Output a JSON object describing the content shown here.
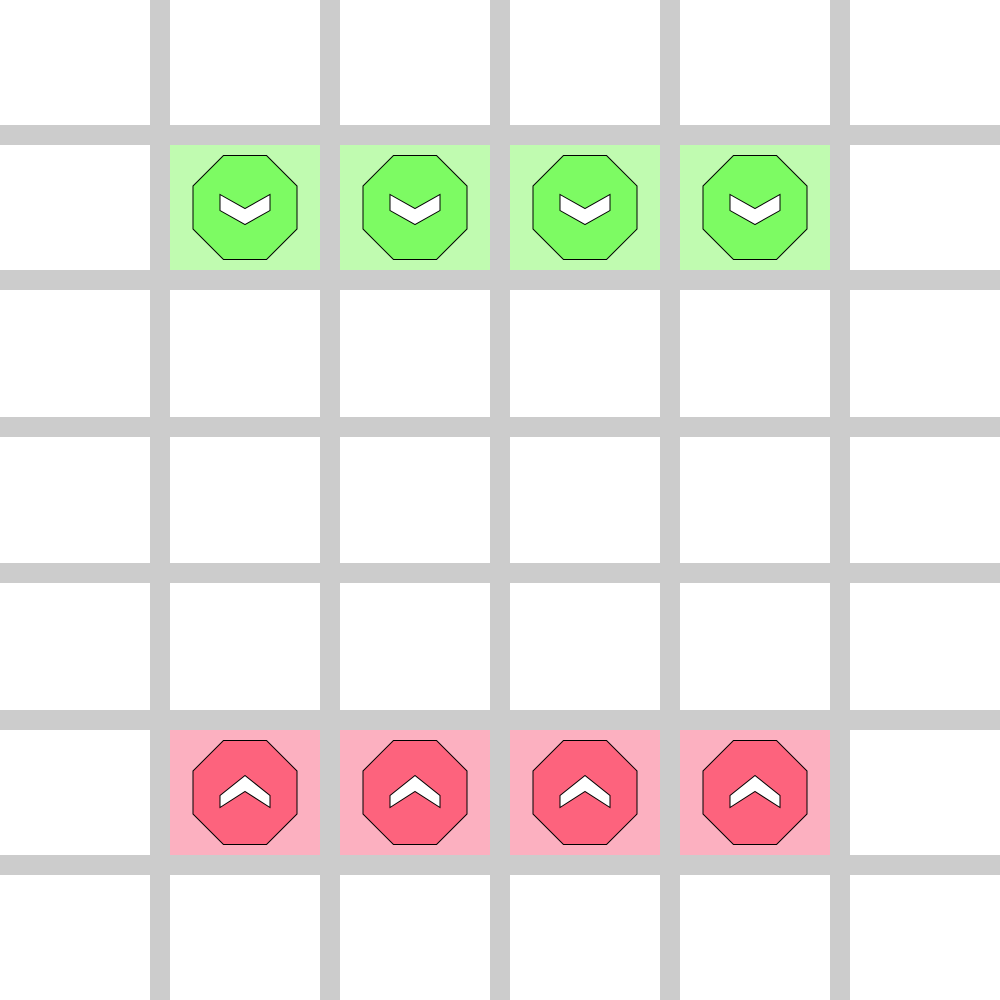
{
  "colors": {
    "background": "#ffffff",
    "grid_line": "#cccccc",
    "green_tile": "#c0fbb0",
    "green_piece": "#7dfb63",
    "red_tile": "#fcb0c0",
    "red_piece": "#fd637d",
    "piece_outline": "#000000",
    "chevron_fill": "#ffffff"
  },
  "board": {
    "columns": 6,
    "rows": 6
  },
  "pieces": [
    {
      "id": "green-1",
      "color": "green",
      "direction": "down",
      "row": 1,
      "col": 1
    },
    {
      "id": "green-2",
      "color": "green",
      "direction": "down",
      "row": 1,
      "col": 2
    },
    {
      "id": "green-3",
      "color": "green",
      "direction": "down",
      "row": 1,
      "col": 3
    },
    {
      "id": "green-4",
      "color": "green",
      "direction": "down",
      "row": 1,
      "col": 4
    },
    {
      "id": "red-1",
      "color": "red",
      "direction": "up",
      "row": 5,
      "col": 1
    },
    {
      "id": "red-2",
      "color": "red",
      "direction": "up",
      "row": 5,
      "col": 2
    },
    {
      "id": "red-3",
      "color": "red",
      "direction": "up",
      "row": 5,
      "col": 3
    },
    {
      "id": "red-4",
      "color": "red",
      "direction": "up",
      "row": 5,
      "col": 4
    }
  ]
}
